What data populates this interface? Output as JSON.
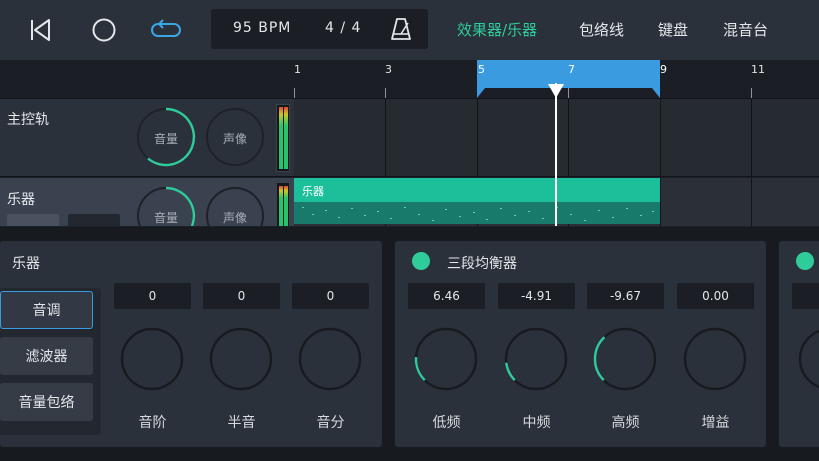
{
  "colors": {
    "accent": "#2ecc9a",
    "loop": "#3a9be0",
    "clip": "#1dbf9b",
    "panel": "#2b313a"
  },
  "toolbar": {
    "icons": [
      "skip-back-icon",
      "record-circle-icon",
      "loop-icon",
      "metronome-icon"
    ],
    "bpm": "95 BPM",
    "time_signature": "4 / 4"
  },
  "nav": {
    "tabs": [
      "效果器/乐器",
      "包络线",
      "键盘",
      "混音台"
    ],
    "active_index": 0
  },
  "ruler": {
    "labels": [
      "1",
      "3",
      "5",
      "7",
      "9",
      "11"
    ]
  },
  "tracks": [
    {
      "name": "主控轨",
      "volume_label": "音量",
      "pan_label": "声像",
      "volume_level": 0.72
    },
    {
      "name": "乐器",
      "volume_label": "音量",
      "pan_label": "声像",
      "volume_level": 0.72,
      "clip_label": "乐器"
    }
  ],
  "instrument_panel": {
    "title": "乐器",
    "side_buttons": [
      "音调",
      "滤波器",
      "音量包络"
    ],
    "active_button": 0,
    "values": [
      "0",
      "0",
      "0"
    ],
    "knob_labels": [
      "音阶",
      "半音",
      "音分"
    ]
  },
  "eq_panel": {
    "title": "三段均衡器",
    "values": [
      "6.46",
      "-4.91",
      "-9.67",
      "0.00"
    ],
    "knob_labels": [
      "低频",
      "中频",
      "高频",
      "增益"
    ],
    "arc_levels": [
      0.18,
      0.14,
      0.34,
      0.0
    ]
  }
}
